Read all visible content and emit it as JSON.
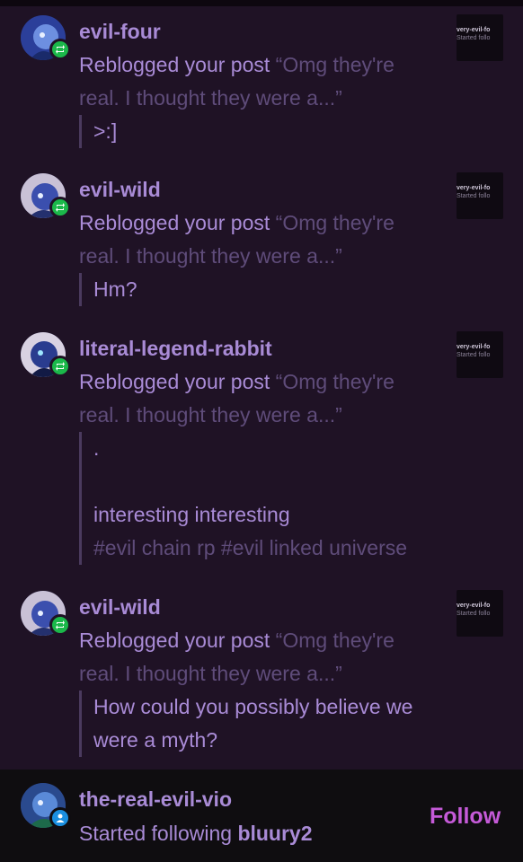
{
  "activity": [
    {
      "username": "evil-four",
      "action": "Reblogged your post",
      "excerpt": "“Omg they're",
      "excerpt2": "real. I thought they were a...”",
      "comment_lines": [
        ">:]"
      ],
      "tags": "",
      "thumb_title": "very-evil-fo",
      "thumb_sub": "Started follo"
    },
    {
      "username": "evil-wild",
      "action": "Reblogged your post",
      "excerpt": "“Omg they're",
      "excerpt2": "real. I thought they were a...”",
      "comment_lines": [
        "Hm?"
      ],
      "tags": "",
      "thumb_title": "very-evil-fo",
      "thumb_sub": "Started follo"
    },
    {
      "username": "literal-legend-rabbit",
      "action": "Reblogged your post",
      "excerpt": "“Omg they're",
      "excerpt2": "real. I thought they were a...”",
      "comment_lines": [
        ".",
        "",
        "interesting interesting"
      ],
      "tags": "#evil chain rp #evil linked universe",
      "thumb_title": "very-evil-fo",
      "thumb_sub": "Started follo"
    },
    {
      "username": "evil-wild",
      "action": "Reblogged your post",
      "excerpt": "“Omg they're",
      "excerpt2": "real. I thought they were a...”",
      "comment_lines": [
        "How could you possibly believe we",
        "were a myth?"
      ],
      "tags": "",
      "thumb_title": "very-evil-fo",
      "thumb_sub": "Started follo"
    }
  ],
  "follow_notice": {
    "username": "the-real-evil-vio",
    "action": "Started following",
    "target": "bluury2",
    "button_label": "Follow"
  },
  "icons": {
    "reblog_badge": "reblog-icon",
    "follow_badge": "person-icon"
  },
  "colors": {
    "background": "#1f1225",
    "accent_text": "#a98bd6",
    "muted_text": "#5f4c7a",
    "reblog_green": "#1bb84a",
    "follow_blue": "#1a8fe0",
    "follow_button": "#c55ad8"
  }
}
